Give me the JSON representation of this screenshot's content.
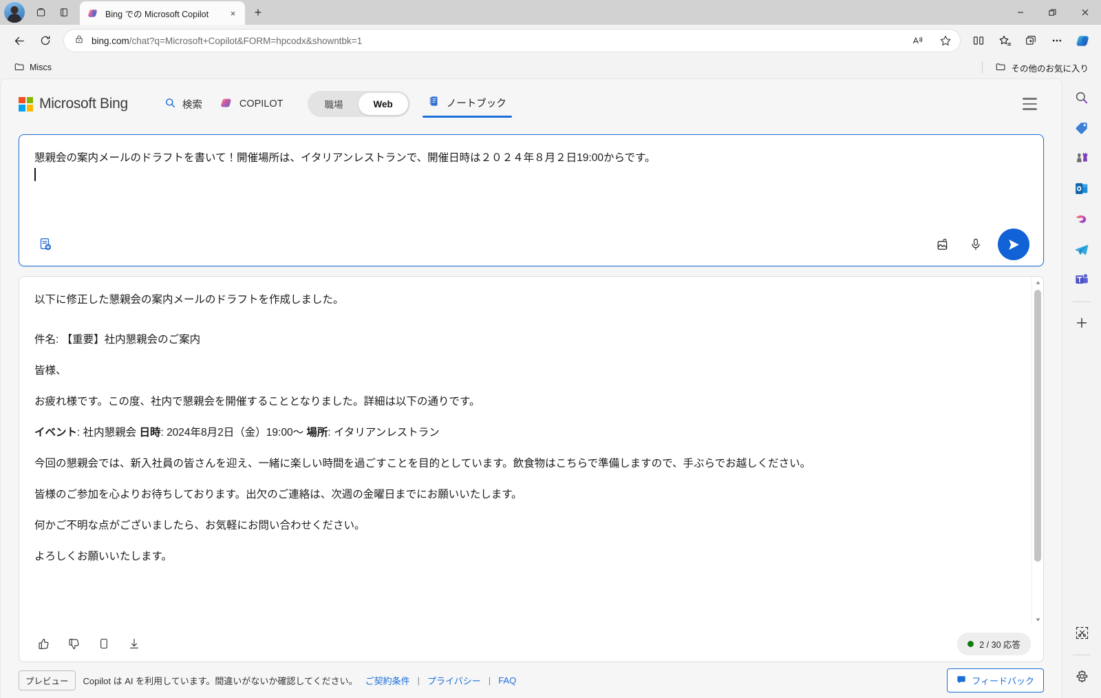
{
  "window": {
    "minimize_label": "最小化",
    "restore_label": "元に戻す",
    "close_label": "閉じる"
  },
  "tab": {
    "title": "Bing での Microsoft Copilot",
    "close_label": "×",
    "new_tab_label": "+"
  },
  "toolbar": {
    "back_label": "戻る",
    "refresh_label": "更新",
    "url_host": "bing.com",
    "url_path": "/chat?q=Microsoft+Copilot&FORM=hpcodx&showntbk=1",
    "read_aloud_label": "音声で読み上げる",
    "favorite_label": "お気に入りに追加",
    "split_screen_label": "画面分割",
    "favorites_label": "お気に入り",
    "collections_label": "コレクション",
    "more_label": "設定など",
    "copilot_label": "Copilot"
  },
  "bookmarks": {
    "items": [
      {
        "label": "Miscs",
        "icon": "folder-icon"
      }
    ],
    "other_favorites": "その他のお気に入り"
  },
  "bing_header": {
    "logo_text": "Microsoft Bing",
    "nav": [
      {
        "label": "検索",
        "icon": "search-icon"
      },
      {
        "label": "COPILOT",
        "icon": "copilot-icon"
      }
    ],
    "toggle": {
      "options": [
        "職場",
        "Web"
      ],
      "selected": "Web"
    },
    "tabs": [
      {
        "label": "ノートブック",
        "icon": "notebook-icon",
        "active": true
      }
    ],
    "menu_label": "メニュー"
  },
  "composer": {
    "text": "懇親会の案内メールのドラフトを書いて！開催場所は、イタリアンレストランで、開催日時は２０２４年８月２日19:00からです。",
    "plugin_label": "ノートブックに追加",
    "image_label": "画像を追加",
    "mic_label": "音声入力",
    "send_label": "送信"
  },
  "response": {
    "paragraphs": [
      {
        "text": "以下に修正した懇親会の案内メールのドラフトを作成しました。",
        "style": "gap"
      },
      {
        "text": "件名: 【重要】社内懇親会のご案内",
        "style": "normal"
      },
      {
        "text": "皆様、",
        "style": "normal"
      },
      {
        "text": "お疲れ様です。この度、社内で懇親会を開催することとなりました。詳細は以下の通りです。",
        "style": "normal"
      },
      {
        "text": "",
        "style": "bolded"
      },
      {
        "text": "今回の懇親会では、新入社員の皆さんを迎え、一緒に楽しい時間を過ごすことを目的としています。飲食物はこちらで準備しますので、手ぶらでお越しください。",
        "style": "normal"
      },
      {
        "text": "皆様のご参加を心よりお待ちしております。出欠のご連絡は、次週の金曜日までにお願いいたします。",
        "style": "normal"
      },
      {
        "text": "何かご不明な点がございましたら、お気軽にお問い合わせください。",
        "style": "normal"
      },
      {
        "text": "よろしくお願いいたします。",
        "style": "normal"
      }
    ],
    "details_line": {
      "event_label": "イベント",
      "event_value": ": 社内懇親会 ",
      "datetime_label": "日時",
      "datetime_value": ": 2024年8月2日（金）19:00〜 ",
      "place_label": "場所",
      "place_value": ": イタリアンレストラン"
    },
    "actions": {
      "like_label": "高く評価",
      "dislike_label": "低く評価",
      "copy_label": "コピー",
      "download_label": "ダウンロード"
    },
    "counter": "2 / 30 応答",
    "counter_dot_color": "#107c10"
  },
  "page_footer": {
    "preview_badge": "プレビュー",
    "disclaimer": "Copilot は AI を利用しています。間違いがないか確認してください。",
    "links": [
      "ご契約条件",
      "プライバシー",
      "FAQ"
    ],
    "separator": "|",
    "feedback_label": "フィードバック"
  },
  "edge_sidebar": {
    "items": [
      {
        "name": "search-icon",
        "label": "検索"
      },
      {
        "name": "shopping-tag-icon",
        "label": "ショッピング"
      },
      {
        "name": "games-icon",
        "label": "ゲーム"
      },
      {
        "name": "outlook-icon",
        "label": "Outlook"
      },
      {
        "name": "designer-icon",
        "label": "Designer"
      },
      {
        "name": "telegram-icon",
        "label": "Telegram"
      },
      {
        "name": "teams-icon",
        "label": "Microsoft Teams"
      },
      {
        "name": "add-icon",
        "label": "追加"
      }
    ],
    "bottom_items": [
      {
        "name": "screenshot-icon",
        "label": "スクリーンショット"
      },
      {
        "name": "settings-gear-icon",
        "label": "設定"
      }
    ]
  },
  "colors": {
    "accent": "#1a6ed8",
    "send_button": "#1062d6",
    "status_green": "#107c10",
    "titlebar": "#d2d2d2",
    "page_bg": "#f6f6f6"
  }
}
